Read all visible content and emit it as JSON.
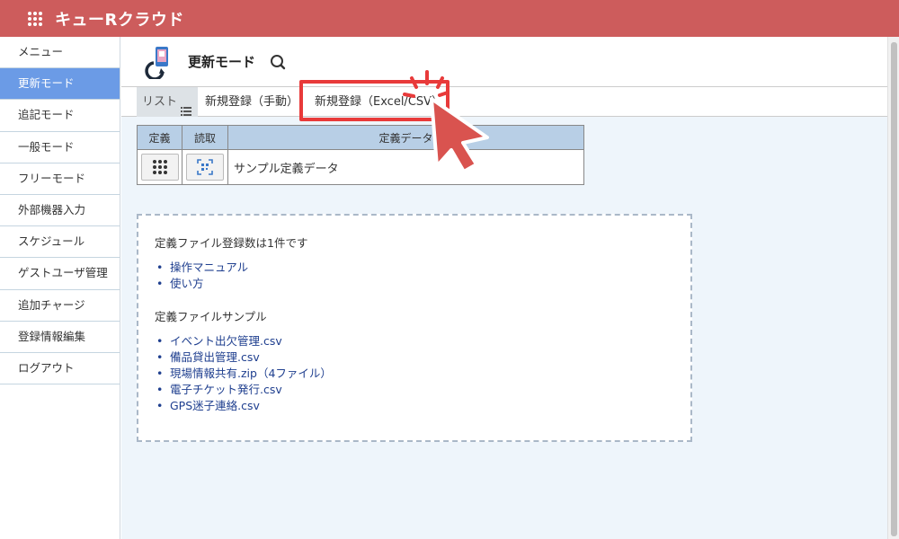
{
  "app": {
    "title": "キューRクラウド"
  },
  "sidebar": {
    "items": [
      {
        "label": "メニュー"
      },
      {
        "label": "更新モード"
      },
      {
        "label": "追記モード"
      },
      {
        "label": "一般モード"
      },
      {
        "label": "フリーモード"
      },
      {
        "label": "外部機器入力"
      },
      {
        "label": "スケジュール"
      },
      {
        "label": "ゲストユーザ管理"
      },
      {
        "label": "追加チャージ"
      },
      {
        "label": "登録情報編集"
      },
      {
        "label": "ログアウト"
      }
    ],
    "active": "更新モード"
  },
  "page": {
    "title": "更新モード"
  },
  "tabs": {
    "list": "リスト",
    "manual": "新規登録（手動）",
    "excel": "新規登録（Excel/CSV）"
  },
  "table": {
    "headers": [
      "定義",
      "読取",
      "定義データ"
    ],
    "rows": [
      {
        "data": "サンプル定義データ"
      }
    ]
  },
  "info": {
    "count_text": "定義ファイル登録数は1件です",
    "links": [
      "操作マニュアル",
      "使い方"
    ],
    "sample_heading": "定義ファイルサンプル",
    "samples": [
      "イベント出欠管理.csv",
      "備品貸出管理.csv",
      "現場情報共有.zip（4ファイル）",
      "電子チケット発行.csv",
      "GPS迷子連絡.csv"
    ]
  },
  "colors": {
    "header": "#cd5c5c",
    "sidebar_active": "#6b9be6",
    "highlight": "#e83a3a",
    "link": "#1f3f8f",
    "table_header": "#b8cfe6"
  }
}
